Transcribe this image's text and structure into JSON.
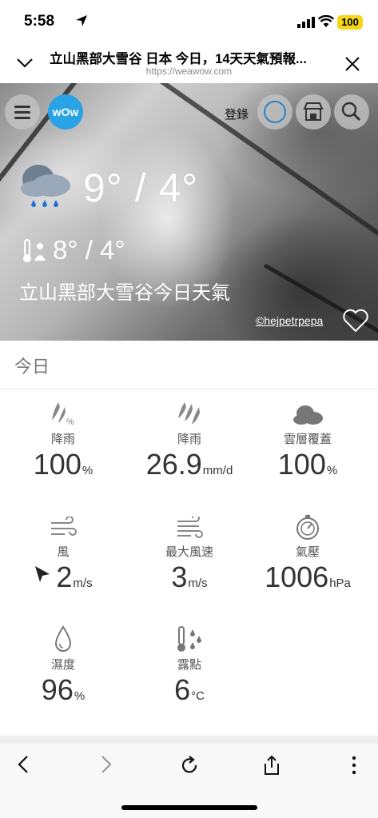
{
  "status_bar": {
    "time": "5:58",
    "battery": "100"
  },
  "browser": {
    "page_title": "立山黑部大雪谷 日本 今日，14天天氣預報...",
    "url": "https://weawow.com"
  },
  "hero": {
    "logo_text": "wOw",
    "login_label": "登錄",
    "temperature": "9° / 4°",
    "feels_like": "8° / 4°",
    "location_title": "立山黑部大雪谷今日天氣",
    "photo_credit": "©hejpetrpepa"
  },
  "today": {
    "section_label": "今日",
    "metrics": [
      {
        "label": "降雨",
        "value": "100",
        "unit": "%",
        "icon": "rain-chance-icon"
      },
      {
        "label": "降雨",
        "value": "26.9",
        "unit": "mm/d",
        "icon": "rain-amount-icon"
      },
      {
        "label": "雲層覆蓋",
        "value": "100",
        "unit": "%",
        "icon": "cloud-icon"
      },
      {
        "label": "風",
        "value": "2",
        "unit": "m/s",
        "icon": "wind-icon"
      },
      {
        "label": "最大風速",
        "value": "3",
        "unit": "m/s",
        "icon": "wind-gust-icon"
      },
      {
        "label": "氣壓",
        "value": "1006",
        "unit": "hPa",
        "icon": "pressure-gauge-icon"
      },
      {
        "label": "濕度",
        "value": "96",
        "unit": "%",
        "icon": "humidity-drop-icon"
      },
      {
        "label": "露點",
        "value": "6",
        "unit": "°C",
        "icon": "dew-point-icon"
      }
    ]
  },
  "colors": {
    "logo_blue": "#2aa3e6",
    "battery_yellow": "#f4d61a"
  }
}
